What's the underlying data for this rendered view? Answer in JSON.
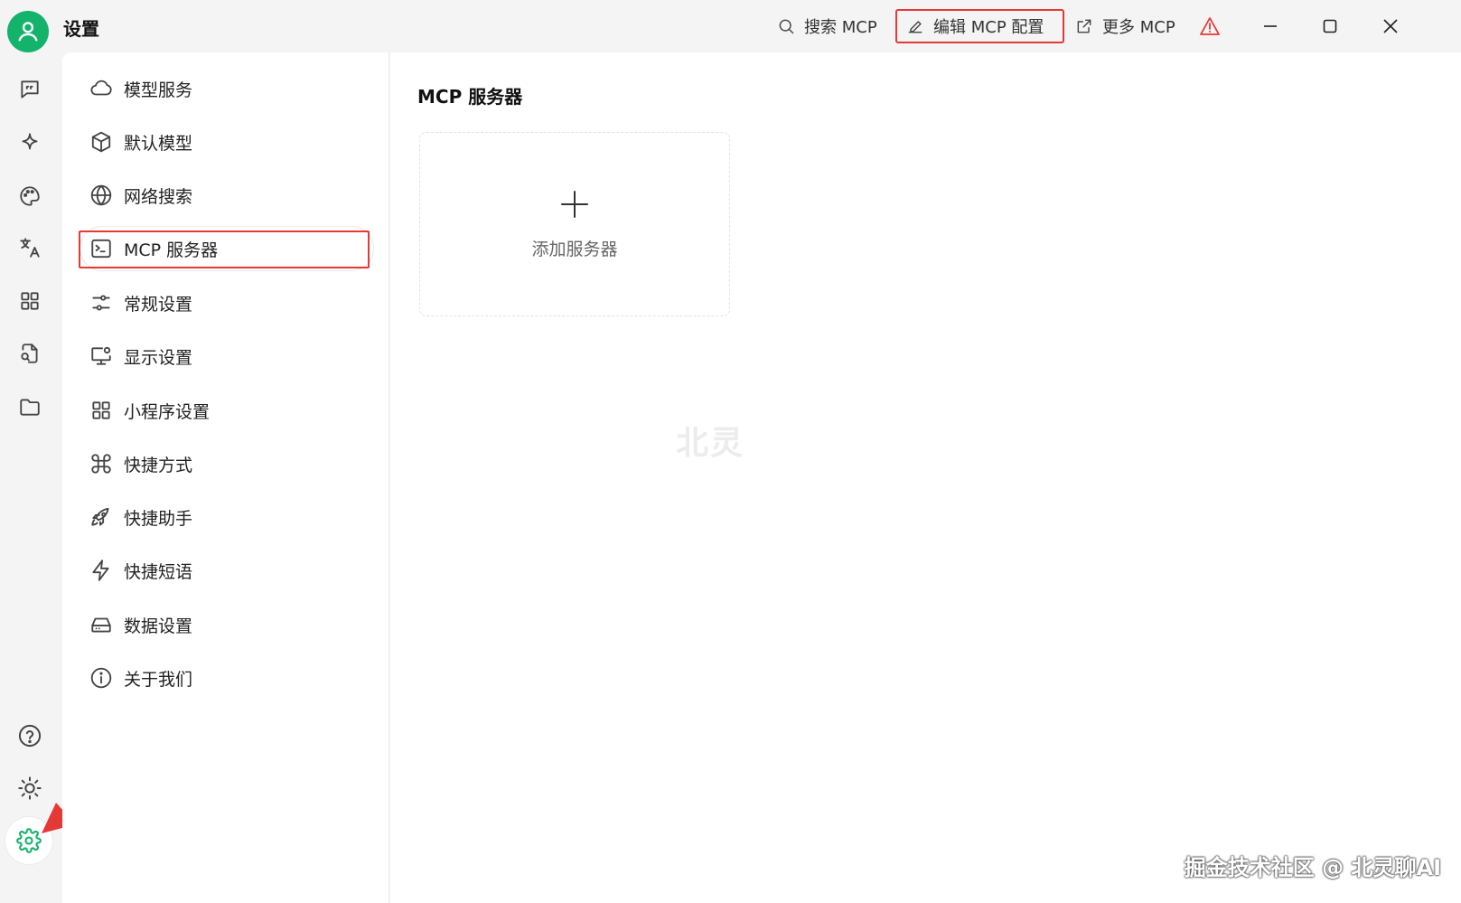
{
  "app": {
    "title": "设置"
  },
  "toolbar": {
    "search_mcp": "搜索 MCP",
    "edit_mcp_config": "编辑 MCP 配置",
    "more_mcp": "更多 MCP"
  },
  "nav": {
    "items": [
      {
        "label": "模型服务",
        "icon": "cloud-icon"
      },
      {
        "label": "默认模型",
        "icon": "cube-icon"
      },
      {
        "label": "网络搜索",
        "icon": "globe-icon"
      },
      {
        "label": "MCP 服务器",
        "icon": "terminal-icon",
        "active": true
      },
      {
        "label": "常规设置",
        "icon": "sliders-icon"
      },
      {
        "label": "显示设置",
        "icon": "monitor-icon"
      },
      {
        "label": "小程序设置",
        "icon": "grid-icon"
      },
      {
        "label": "快捷方式",
        "icon": "command-icon"
      },
      {
        "label": "快捷助手",
        "icon": "rocket-icon"
      },
      {
        "label": "快捷短语",
        "icon": "zap-icon"
      },
      {
        "label": "数据设置",
        "icon": "drive-icon"
      },
      {
        "label": "关于我们",
        "icon": "info-icon"
      }
    ]
  },
  "main": {
    "title": "MCP 服务器",
    "add_server_label": "添加服务器"
  },
  "watermarks": {
    "center": "北灵",
    "bottom": "掘金技术社区 @ 北灵聊AI"
  },
  "colors": {
    "accent": "#13b36b",
    "highlight": "#e53935"
  }
}
